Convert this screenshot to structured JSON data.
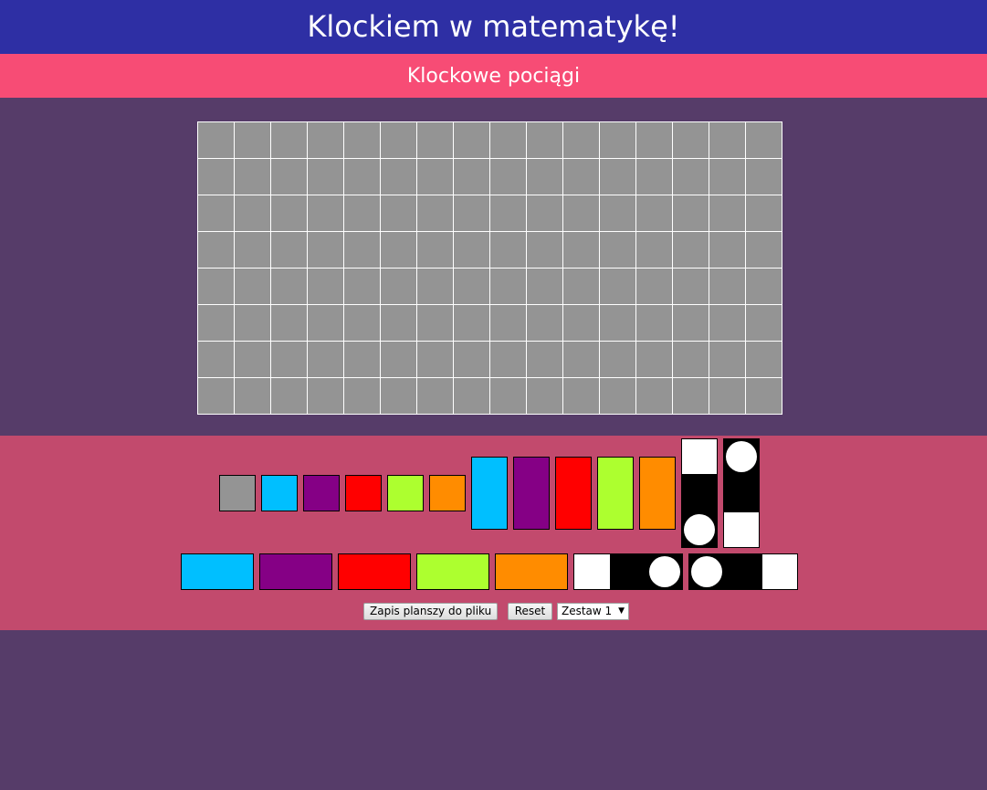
{
  "header": {
    "title": "Klockiem w matematykę!"
  },
  "subheader": {
    "title": "Klockowe pociągi"
  },
  "board": {
    "columns": 16,
    "rows": 8,
    "cell_color": "#949494",
    "line_color": "#ffffff"
  },
  "palette": {
    "small_blocks": [
      "#949494",
      "#00bfff",
      "#850085",
      "#ff0000",
      "#adff2f",
      "#ff8c00"
    ],
    "vertical_blocks": [
      "#00bfff",
      "#850085",
      "#ff0000",
      "#adff2f",
      "#ff8c00"
    ],
    "horizontal_blocks": [
      "#00bfff",
      "#850085",
      "#ff0000",
      "#adff2f",
      "#ff8c00"
    ]
  },
  "controls": {
    "save_label": "Zapis planszy do pliku",
    "reset_label": "Reset",
    "set_select_value": "Zestaw 1"
  },
  "colors": {
    "header_bg": "#2e2fa4",
    "subheader_bg": "#f74c75",
    "page_bg": "#563c69",
    "palette_bg": "#c24a6d"
  }
}
